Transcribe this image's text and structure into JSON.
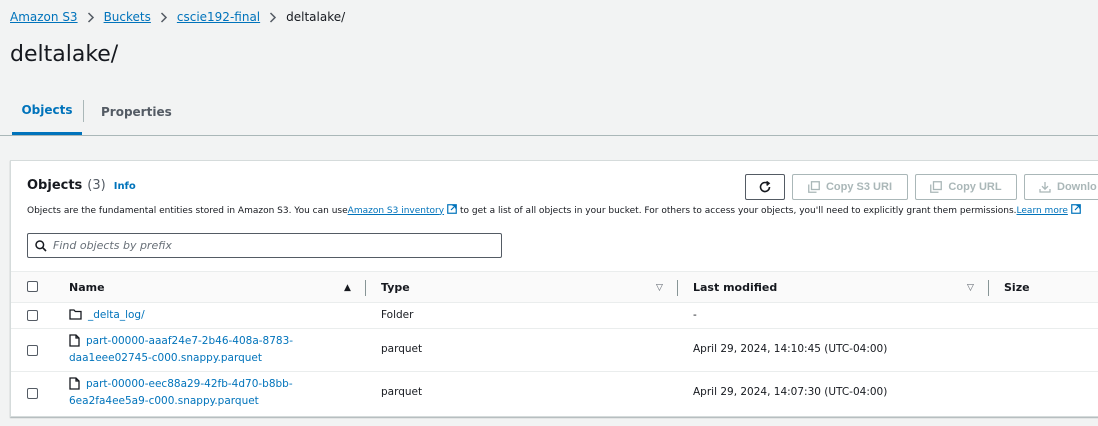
{
  "breadcrumb": {
    "items": [
      "Amazon S3",
      "Buckets",
      "cscie192-final"
    ],
    "current": "deltalake/"
  },
  "page": {
    "title": "deltalake/"
  },
  "tabs": [
    {
      "label": "Objects",
      "active": true
    },
    {
      "label": "Properties",
      "active": false
    }
  ],
  "objects_panel": {
    "title": "Objects",
    "count": "(3)",
    "info": "Info",
    "description": {
      "part1": "Objects are the fundamental entities stored in Amazon S3. You can use ",
      "link1": "Amazon S3 inventory",
      "part2": " to get a list of all objects in your bucket. For others to access your objects, you'll need to explicitly grant them permissions. ",
      "link2": "Learn more"
    },
    "buttons": {
      "refresh_icon": "refresh-icon",
      "copy_s3_uri": "Copy S3 URI",
      "copy_url": "Copy URL",
      "download": "Downlo"
    },
    "search": {
      "placeholder": "Find objects by prefix",
      "value": ""
    }
  },
  "table": {
    "columns": {
      "name": "Name",
      "type": "Type",
      "last_modified": "Last modified",
      "size": "Size"
    },
    "rows": [
      {
        "icon": "folder-icon",
        "name_line1": "_delta_log/",
        "name_line2": "",
        "type": "Folder",
        "last_modified": "-",
        "size": ""
      },
      {
        "icon": "file-icon",
        "name_line1": "part-00000-aaaf24e7-2b46-408a-8783-",
        "name_line2": "daa1eee02745-c000.snappy.parquet",
        "type": "parquet",
        "last_modified": "April 29, 2024, 14:10:45 (UTC-04:00)",
        "size": ""
      },
      {
        "icon": "file-icon",
        "name_line1": "part-00000-eec88a29-42fb-4d70-b8bb-",
        "name_line2": "6ea2fa4ee5a9-c000.snappy.parquet",
        "type": "parquet",
        "last_modified": "April 29, 2024, 14:07:30 (UTC-04:00)",
        "size": ""
      }
    ]
  },
  "colors": {
    "link": "#0073bb",
    "text": "#16191f",
    "disabled": "#aab7b8",
    "background": "#f2f3f3"
  }
}
